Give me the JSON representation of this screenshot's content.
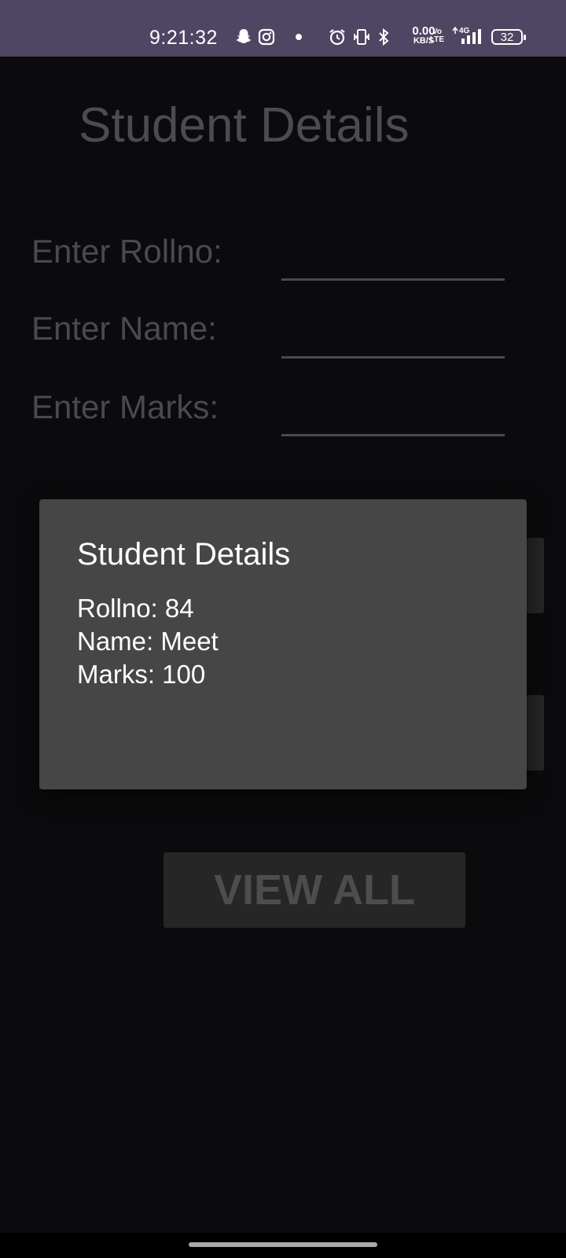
{
  "status_bar": {
    "time": "9:21:32",
    "net_speed_value": "0.00",
    "net_speed_unit": "KB/S",
    "volte_top": "Vo",
    "volte_bottom": "LTE",
    "network": "4G",
    "battery": "32",
    "icons": [
      "snapchat-icon",
      "instagram-icon",
      "dot-icon",
      "alarm-icon",
      "vibrate-icon",
      "bluetooth-icon",
      "signal-icon",
      "battery-icon"
    ]
  },
  "app": {
    "title": "Student Details",
    "form": {
      "rollno_label": "Enter Rollno:",
      "name_label": "Enter Name:",
      "marks_label": "Enter Marks:",
      "rollno_value": "",
      "name_value": "",
      "marks_value": ""
    },
    "view_all_label": "VIEW ALL"
  },
  "dialog": {
    "title": "Student Details",
    "rollno_line": "Rollno: 84",
    "name_line": "Name: Meet",
    "marks_line": "Marks: 100"
  }
}
